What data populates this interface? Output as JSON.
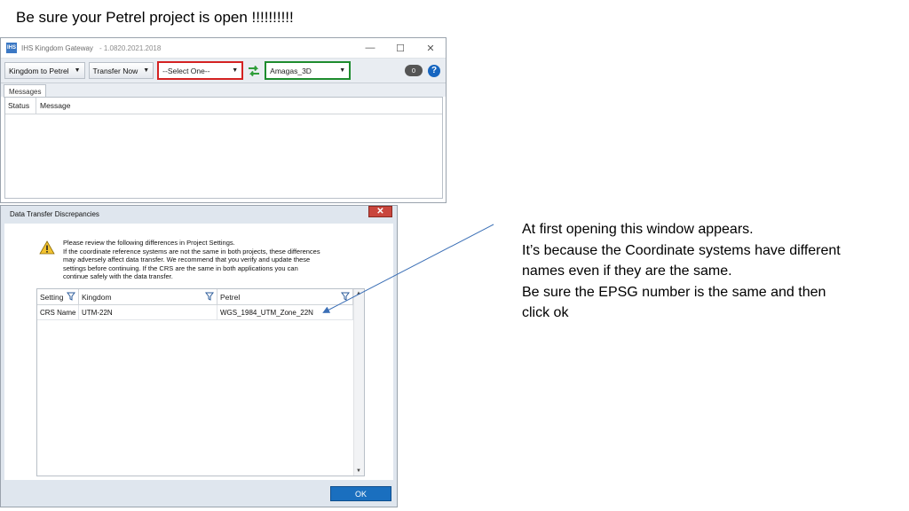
{
  "slide": {
    "title": "Be sure your Petrel project is open !!!!!!!!!!"
  },
  "window": {
    "app_icon_text": "IHS",
    "title": "IHS Kingdom Gateway",
    "version": "-  1.0820.2021.2018",
    "minimize_glyph": "—",
    "maximize_glyph": "☐",
    "close_glyph": "✕"
  },
  "toolbar": {
    "direction_label": "Kingdom to  Petrel",
    "transfer_label": "Transfer Now",
    "dropdown_glyph": "▼",
    "source_select_value": "--Select One--",
    "target_select_value": "Amagas_3D",
    "message_count": "0",
    "help_glyph": "?"
  },
  "messages": {
    "tab_label": "Messages",
    "columns": [
      "Status",
      "Message"
    ]
  },
  "dialog": {
    "title": "Data Transfer Discrepancies",
    "close_glyph": "✕",
    "text_lines": [
      "Please review the following differences in Project Settings.",
      "If the coordinate reference systems are not the same in both projects, these differences",
      "may adversely affect data transfer.  We recommend that you verify and update these",
      "settings before continuing.  If the CRS are the same in both applications you can",
      "continue safely with the data transfer."
    ],
    "columns": [
      "Setting",
      "Kingdom",
      "Petrel"
    ],
    "rows": [
      [
        "CRS Name",
        "UTM-22N",
        "WGS_1984_UTM_Zone_22N"
      ]
    ],
    "ok_label": "OK"
  },
  "annotation": {
    "lines": [
      "At first opening this window appears.",
      "It’s because the Coordinate systems have different",
      "names even if they are the same.",
      "Be sure the EPSG number is the same and then",
      "click ok"
    ]
  },
  "colors": {
    "select_one_border": "#d42222",
    "project_select_border": "#1e8c2e",
    "ok_button": "#1a6fbf",
    "help_icon": "#1565c0"
  }
}
